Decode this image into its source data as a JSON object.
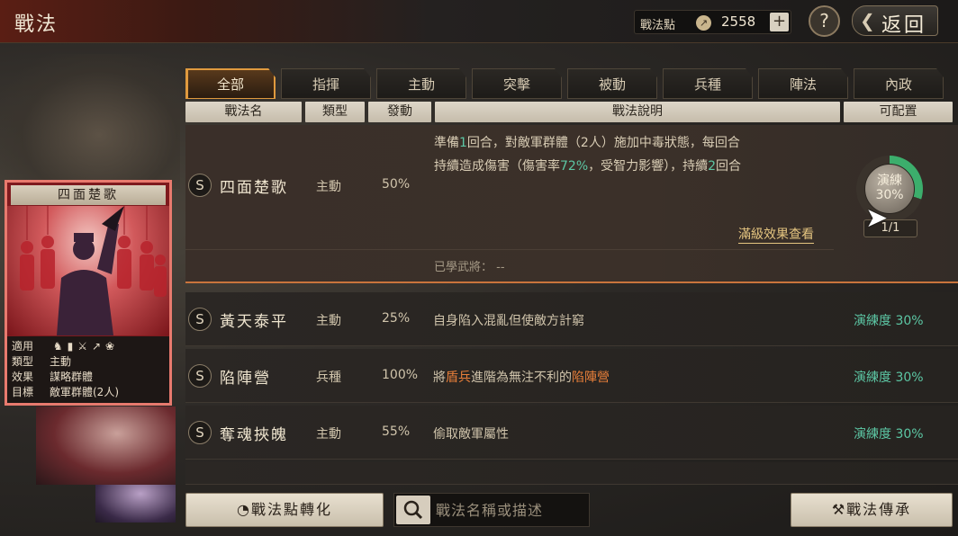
{
  "header": {
    "title": "戰法",
    "points_label": "戰法點",
    "points_value": "2558",
    "add_label": "+",
    "help_label": "?",
    "back_label": "返回"
  },
  "tabs": [
    {
      "label": "全部",
      "active": true
    },
    {
      "label": "指揮",
      "active": false
    },
    {
      "label": "主動",
      "active": false
    },
    {
      "label": "突擊",
      "active": false
    },
    {
      "label": "被動",
      "active": false
    },
    {
      "label": "兵種",
      "active": false
    },
    {
      "label": "陣法",
      "active": false
    },
    {
      "label": "內政",
      "active": false
    }
  ],
  "columns": {
    "name": "戰法名",
    "type": "類型",
    "rate": "發動",
    "desc": "戰法說明",
    "config": "可配置"
  },
  "card": {
    "title": "四面楚歌",
    "rows": [
      {
        "key": "適用",
        "value": ""
      },
      {
        "key": "類型",
        "value": "主動"
      },
      {
        "key": "效果",
        "value": "謀略群體"
      },
      {
        "key": "目標",
        "value": "敵軍群體(2人)"
      }
    ]
  },
  "expanded": {
    "badge": "S",
    "name": "四面楚歌",
    "type": "主動",
    "rate": "50%",
    "desc_line1_a": "準備",
    "desc_line1_n": "1",
    "desc_line1_b": "回合，對敵軍群體（2人）施加中毒狀態，每回合",
    "desc_line2_a": "持續造成傷害（傷害率",
    "desc_line2_n": "72%",
    "desc_line2_b": "，受智力影響），持續",
    "desc_line2_m": "2",
    "desc_line2_c": "回合",
    "link": "滿級效果查看",
    "learned_label": "已學武將：",
    "learned_value": "--",
    "gauge_label": "演練",
    "gauge_pct": "30%",
    "gauge_progress": 0.3,
    "gauge_count": "1/1"
  },
  "rows": [
    {
      "badge": "S",
      "name": "黃天泰平",
      "type": "主動",
      "rate": "25%",
      "desc_a": "自身陷入混亂但使敵方計窮",
      "desc_hl1": "",
      "desc_b": "",
      "desc_hl2": "",
      "prof": "演練度 30%"
    },
    {
      "badge": "S",
      "name": "陷陣營",
      "type": "兵種",
      "rate": "100%",
      "desc_a": "將",
      "desc_hl1": "盾兵",
      "desc_b": "進階為無注不利的",
      "desc_hl2": "陷陣營",
      "prof": "演練度 30%"
    },
    {
      "badge": "S",
      "name": "奪魂挾魄",
      "type": "主動",
      "rate": "55%",
      "desc_a": "偷取敵軍屬性",
      "desc_hl1": "",
      "desc_b": "",
      "desc_hl2": "",
      "prof": "演練度 30%"
    }
  ],
  "footer": {
    "convert_label": "戰法點轉化",
    "search_placeholder": "戰法名稱或描述",
    "inherit_label": "戰法傳承"
  },
  "colors": {
    "accent": "#e09a3e",
    "highlight": "#e87f3a",
    "proficiency": "#5cc7a4",
    "card_border": "#e87a6e"
  }
}
